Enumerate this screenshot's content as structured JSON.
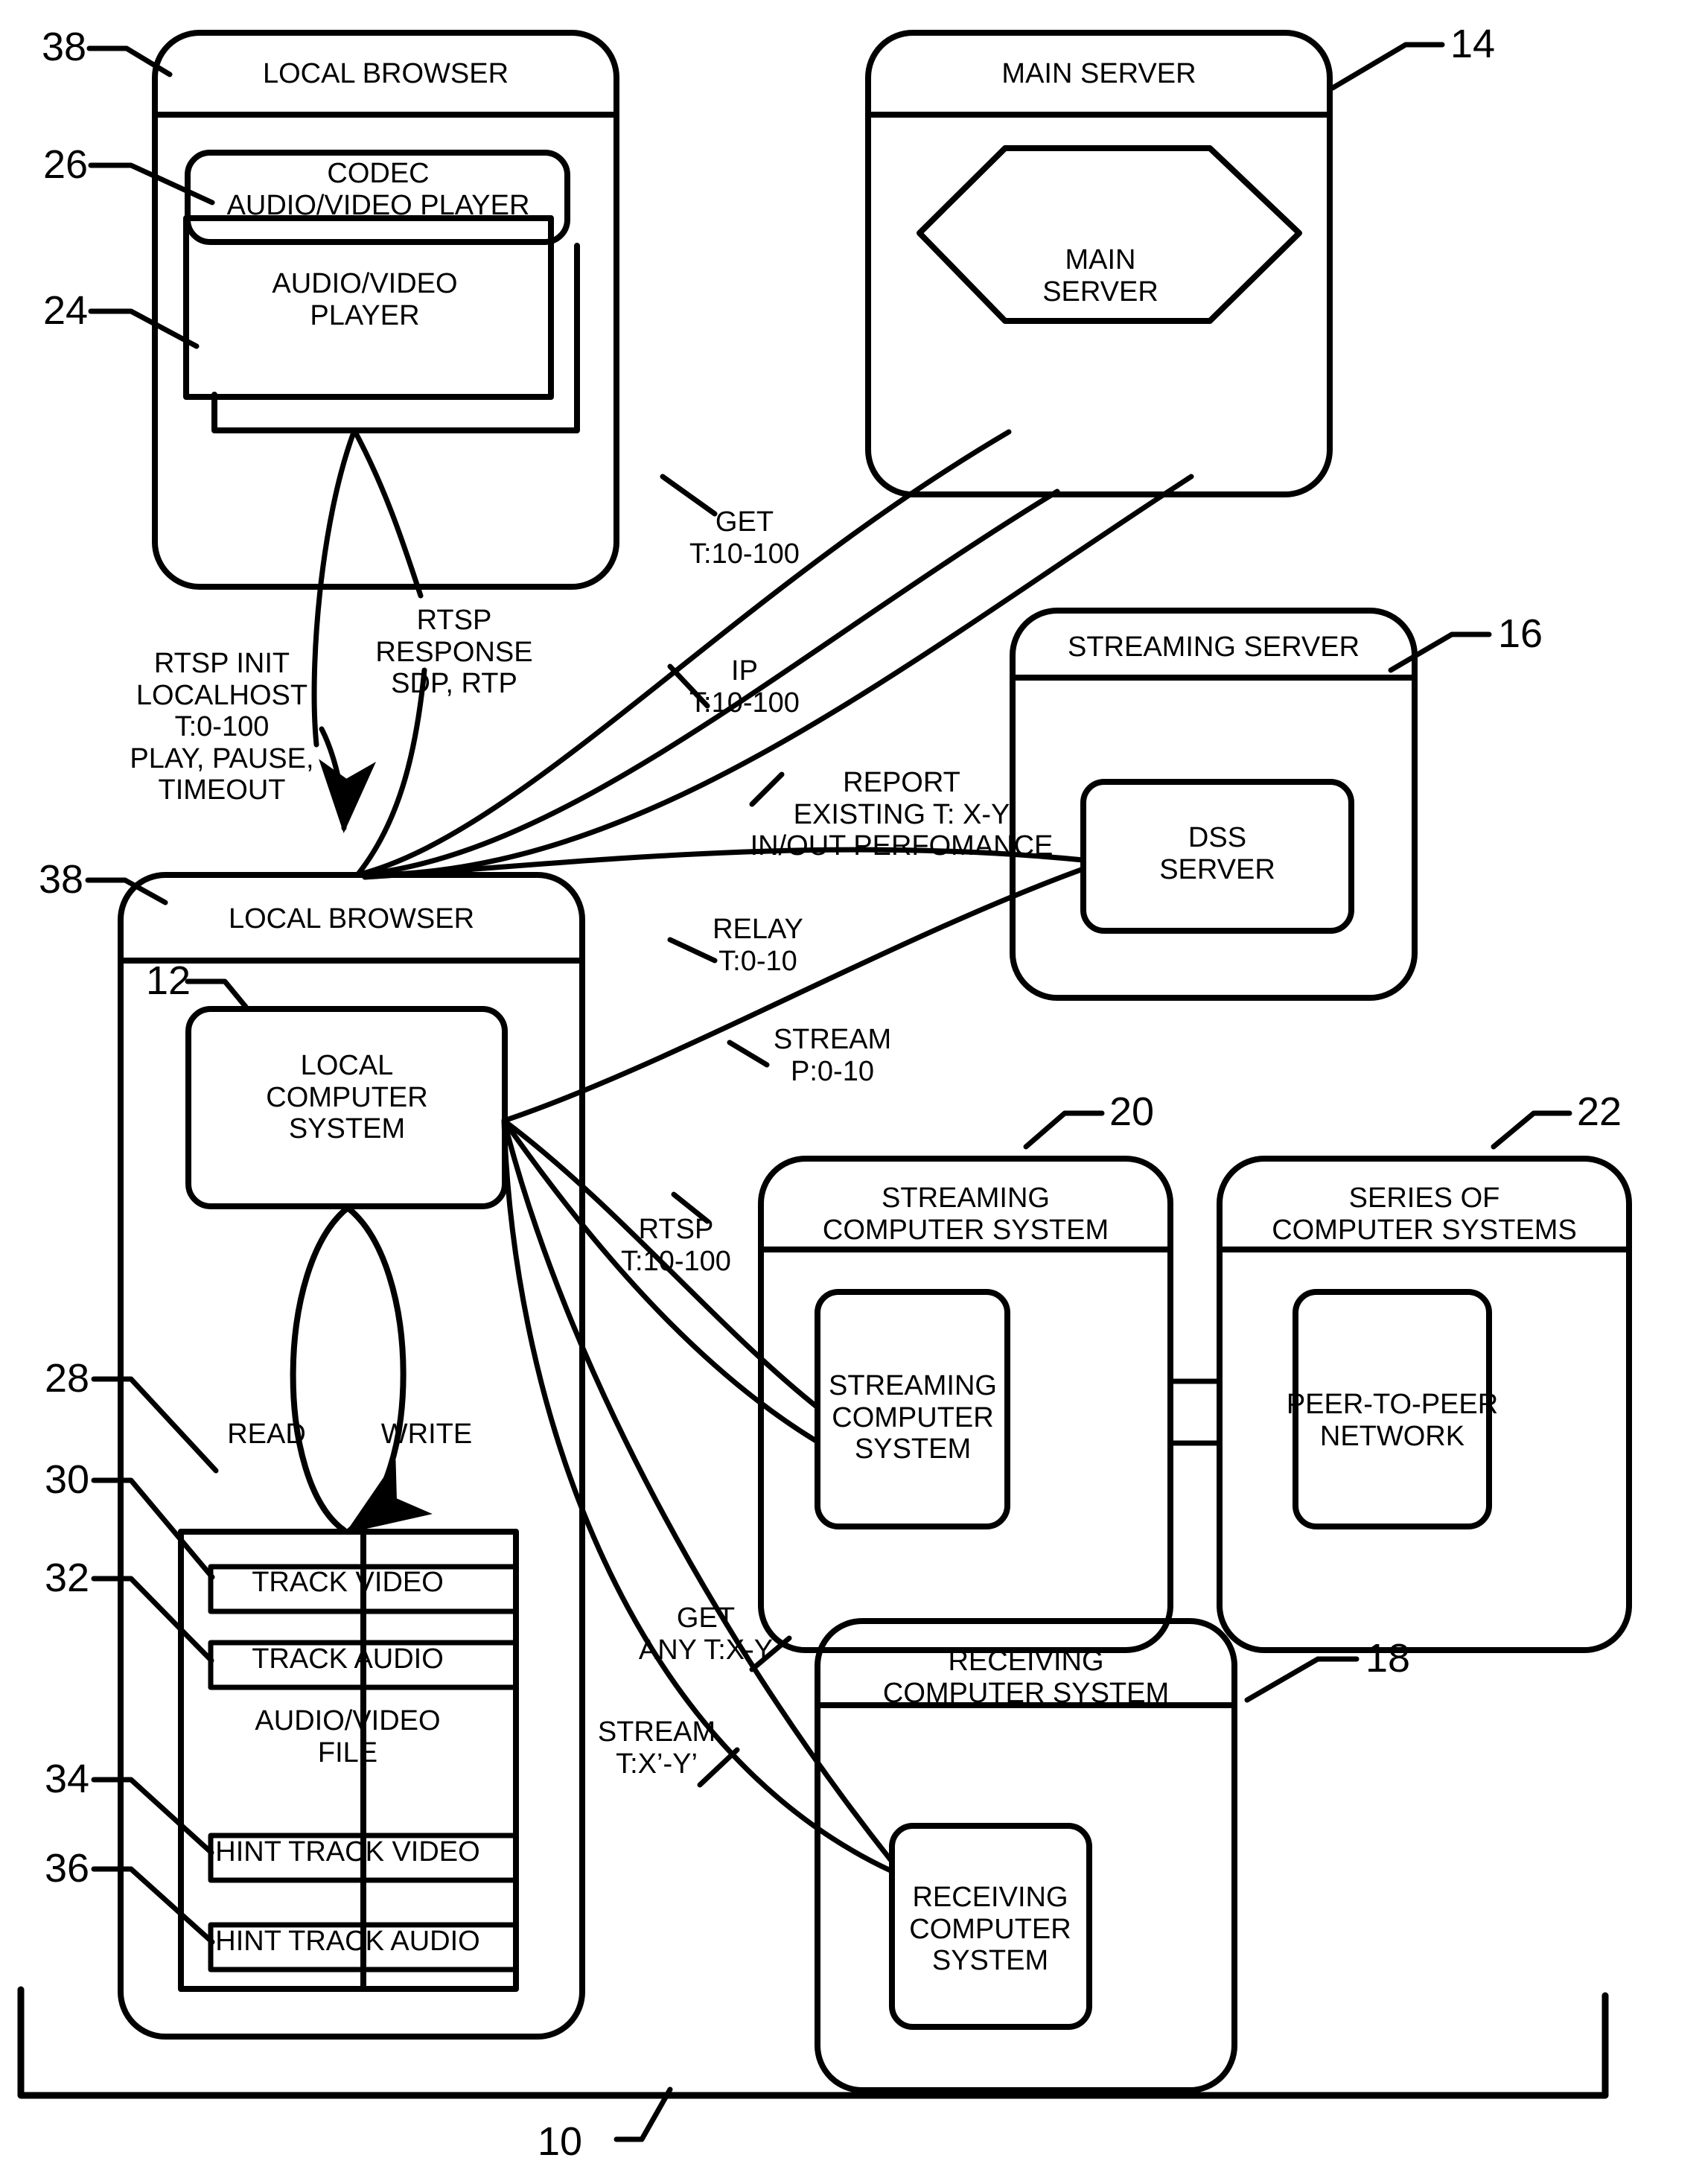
{
  "figure": {
    "type": "patent-block-diagram",
    "overall_ref": "10",
    "stroke_color": "#000000",
    "background_color": "#ffffff"
  },
  "blocks": {
    "local_browser_top": {
      "ref": "38",
      "title": "LOCAL BROWSER",
      "children": {
        "codec_player": {
          "ref": "26",
          "label": "CODEC\nAUDIO/VIDEO PLAYER"
        },
        "av_player": {
          "ref": "24",
          "label": "AUDIO/VIDEO\nPLAYER"
        }
      }
    },
    "main_server": {
      "ref": "14",
      "title": "MAIN SERVER",
      "children": {
        "main_server_hex": {
          "label": "MAIN\nSERVER"
        }
      }
    },
    "streaming_server": {
      "ref": "16",
      "title": "STREAMING SERVER",
      "children": {
        "dss_server": {
          "label": "DSS\nSERVER"
        }
      }
    },
    "local_browser_bottom": {
      "ref": "38",
      "title": "LOCAL BROWSER",
      "children": {
        "local_computer_system": {
          "ref": "12",
          "label": "LOCAL\nCOMPUTER\nSYSTEM"
        },
        "av_file": {
          "ref": "28",
          "label": "AUDIO/VIDEO\nFILE",
          "tracks": [
            {
              "ref": "30",
              "label": "TRACK VIDEO"
            },
            {
              "ref": "32",
              "label": "TRACK AUDIO"
            },
            {
              "ref": "34",
              "label": "HINT TRACK VIDEO"
            },
            {
              "ref": "36",
              "label": "HINT TRACK AUDIO"
            }
          ]
        }
      }
    },
    "streaming_computer_system": {
      "ref": "20",
      "title": "STREAMING\nCOMPUTER SYSTEM",
      "children": {
        "inner": {
          "label": "STREAMING\nCOMPUTER\nSYSTEM"
        }
      }
    },
    "series_of_computer_systems": {
      "ref": "22",
      "title": "SERIES OF\nCOMPUTER SYSTEMS",
      "children": {
        "inner": {
          "label": "PEER-TO-PEER\nNETWORK"
        }
      }
    },
    "receiving_computer_system": {
      "ref": "18",
      "title": "RECEIVING\nCOMPUTER SYSTEM",
      "children": {
        "inner": {
          "label": "RECEIVING\nCOMPUTER\nSYSTEM"
        }
      }
    }
  },
  "edge_labels": {
    "rtsp_init": "RTSP INIT\nLOCALHOST\nT:0-100\nPLAY, PAUSE,\nTIMEOUT",
    "rtsp_response": "RTSP\nRESPONSE\nSDP, RTP",
    "get_t10_100": "GET\nT:10-100",
    "ip_t10_100": "IP\nT:10-100",
    "report_existing": "REPORT\nEXISTING T: X-Y\nIN/OUT PERFOMANCE",
    "relay_t0_10": "RELAY\nT:0-10",
    "stream_p0_10": "STREAM\nP:0-10",
    "rtsp_t10_100": "RTSP\nT:10-100",
    "get_any_txy": "GET\nANY T:X-Y",
    "stream_txy_prime": "STREAM\nT:X’-Y’",
    "read": "READ",
    "write": "WRITE"
  },
  "ref_numbers": [
    "38",
    "26",
    "24",
    "14",
    "16",
    "38",
    "12",
    "28",
    "30",
    "32",
    "34",
    "36",
    "20",
    "22",
    "18",
    "10"
  ]
}
